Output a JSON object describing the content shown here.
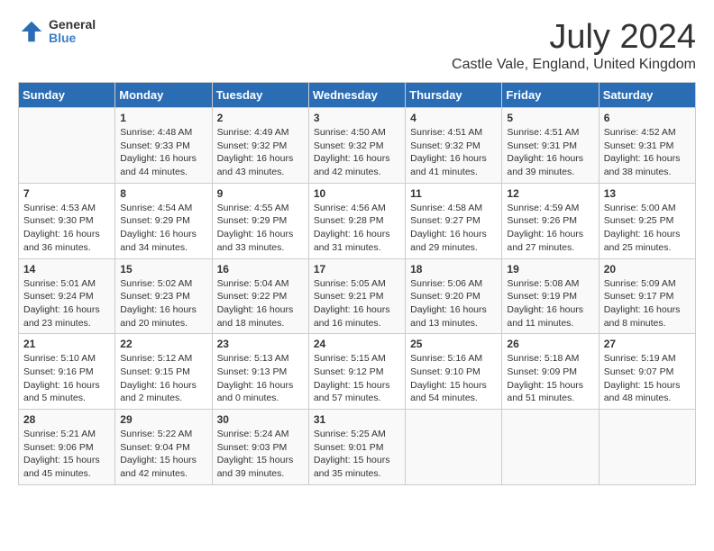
{
  "header": {
    "logo_line1": "General",
    "logo_line2": "Blue",
    "month_title": "July 2024",
    "location": "Castle Vale, England, United Kingdom"
  },
  "days_of_week": [
    "Sunday",
    "Monday",
    "Tuesday",
    "Wednesday",
    "Thursday",
    "Friday",
    "Saturday"
  ],
  "weeks": [
    [
      {
        "day": "",
        "info": ""
      },
      {
        "day": "1",
        "info": "Sunrise: 4:48 AM\nSunset: 9:33 PM\nDaylight: 16 hours\nand 44 minutes."
      },
      {
        "day": "2",
        "info": "Sunrise: 4:49 AM\nSunset: 9:32 PM\nDaylight: 16 hours\nand 43 minutes."
      },
      {
        "day": "3",
        "info": "Sunrise: 4:50 AM\nSunset: 9:32 PM\nDaylight: 16 hours\nand 42 minutes."
      },
      {
        "day": "4",
        "info": "Sunrise: 4:51 AM\nSunset: 9:32 PM\nDaylight: 16 hours\nand 41 minutes."
      },
      {
        "day": "5",
        "info": "Sunrise: 4:51 AM\nSunset: 9:31 PM\nDaylight: 16 hours\nand 39 minutes."
      },
      {
        "day": "6",
        "info": "Sunrise: 4:52 AM\nSunset: 9:31 PM\nDaylight: 16 hours\nand 38 minutes."
      }
    ],
    [
      {
        "day": "7",
        "info": "Sunrise: 4:53 AM\nSunset: 9:30 PM\nDaylight: 16 hours\nand 36 minutes."
      },
      {
        "day": "8",
        "info": "Sunrise: 4:54 AM\nSunset: 9:29 PM\nDaylight: 16 hours\nand 34 minutes."
      },
      {
        "day": "9",
        "info": "Sunrise: 4:55 AM\nSunset: 9:29 PM\nDaylight: 16 hours\nand 33 minutes."
      },
      {
        "day": "10",
        "info": "Sunrise: 4:56 AM\nSunset: 9:28 PM\nDaylight: 16 hours\nand 31 minutes."
      },
      {
        "day": "11",
        "info": "Sunrise: 4:58 AM\nSunset: 9:27 PM\nDaylight: 16 hours\nand 29 minutes."
      },
      {
        "day": "12",
        "info": "Sunrise: 4:59 AM\nSunset: 9:26 PM\nDaylight: 16 hours\nand 27 minutes."
      },
      {
        "day": "13",
        "info": "Sunrise: 5:00 AM\nSunset: 9:25 PM\nDaylight: 16 hours\nand 25 minutes."
      }
    ],
    [
      {
        "day": "14",
        "info": "Sunrise: 5:01 AM\nSunset: 9:24 PM\nDaylight: 16 hours\nand 23 minutes."
      },
      {
        "day": "15",
        "info": "Sunrise: 5:02 AM\nSunset: 9:23 PM\nDaylight: 16 hours\nand 20 minutes."
      },
      {
        "day": "16",
        "info": "Sunrise: 5:04 AM\nSunset: 9:22 PM\nDaylight: 16 hours\nand 18 minutes."
      },
      {
        "day": "17",
        "info": "Sunrise: 5:05 AM\nSunset: 9:21 PM\nDaylight: 16 hours\nand 16 minutes."
      },
      {
        "day": "18",
        "info": "Sunrise: 5:06 AM\nSunset: 9:20 PM\nDaylight: 16 hours\nand 13 minutes."
      },
      {
        "day": "19",
        "info": "Sunrise: 5:08 AM\nSunset: 9:19 PM\nDaylight: 16 hours\nand 11 minutes."
      },
      {
        "day": "20",
        "info": "Sunrise: 5:09 AM\nSunset: 9:17 PM\nDaylight: 16 hours\nand 8 minutes."
      }
    ],
    [
      {
        "day": "21",
        "info": "Sunrise: 5:10 AM\nSunset: 9:16 PM\nDaylight: 16 hours\nand 5 minutes."
      },
      {
        "day": "22",
        "info": "Sunrise: 5:12 AM\nSunset: 9:15 PM\nDaylight: 16 hours\nand 2 minutes."
      },
      {
        "day": "23",
        "info": "Sunrise: 5:13 AM\nSunset: 9:13 PM\nDaylight: 16 hours\nand 0 minutes."
      },
      {
        "day": "24",
        "info": "Sunrise: 5:15 AM\nSunset: 9:12 PM\nDaylight: 15 hours\nand 57 minutes."
      },
      {
        "day": "25",
        "info": "Sunrise: 5:16 AM\nSunset: 9:10 PM\nDaylight: 15 hours\nand 54 minutes."
      },
      {
        "day": "26",
        "info": "Sunrise: 5:18 AM\nSunset: 9:09 PM\nDaylight: 15 hours\nand 51 minutes."
      },
      {
        "day": "27",
        "info": "Sunrise: 5:19 AM\nSunset: 9:07 PM\nDaylight: 15 hours\nand 48 minutes."
      }
    ],
    [
      {
        "day": "28",
        "info": "Sunrise: 5:21 AM\nSunset: 9:06 PM\nDaylight: 15 hours\nand 45 minutes."
      },
      {
        "day": "29",
        "info": "Sunrise: 5:22 AM\nSunset: 9:04 PM\nDaylight: 15 hours\nand 42 minutes."
      },
      {
        "day": "30",
        "info": "Sunrise: 5:24 AM\nSunset: 9:03 PM\nDaylight: 15 hours\nand 39 minutes."
      },
      {
        "day": "31",
        "info": "Sunrise: 5:25 AM\nSunset: 9:01 PM\nDaylight: 15 hours\nand 35 minutes."
      },
      {
        "day": "",
        "info": ""
      },
      {
        "day": "",
        "info": ""
      },
      {
        "day": "",
        "info": ""
      }
    ]
  ]
}
